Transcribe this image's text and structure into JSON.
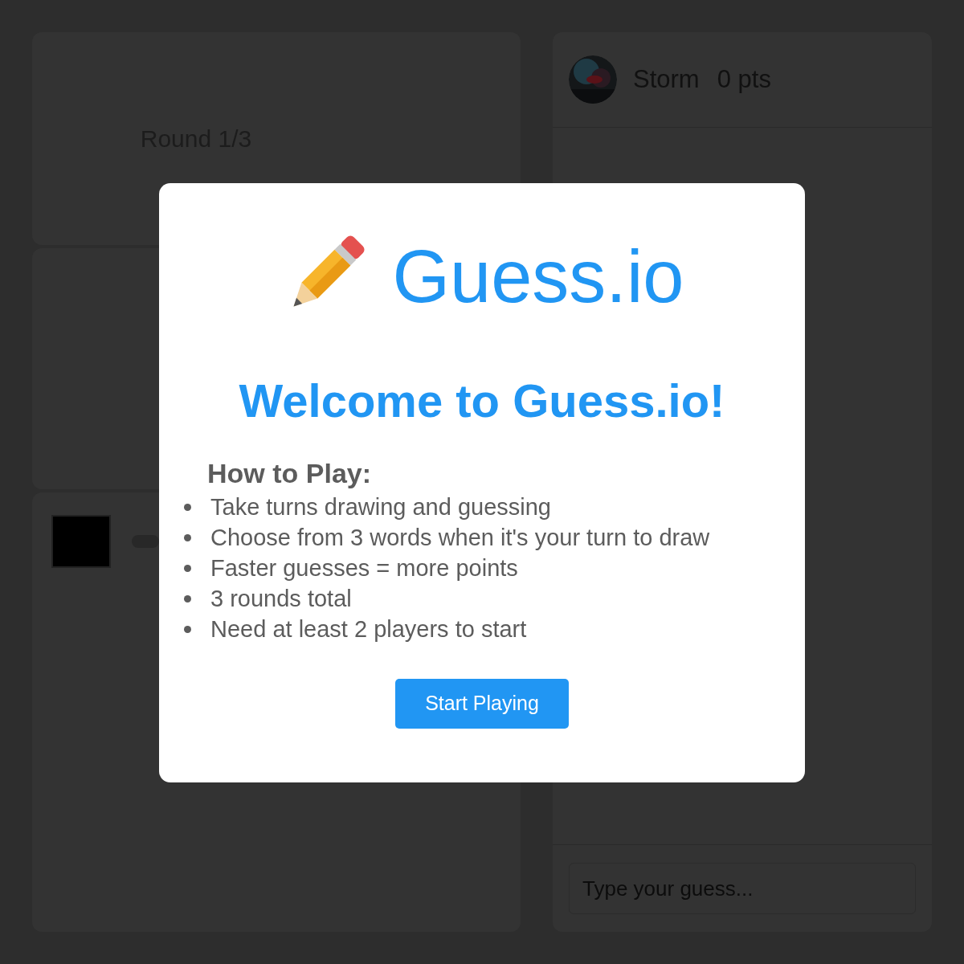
{
  "game": {
    "round": "Round 1/3"
  },
  "players": [
    {
      "name": "Storm",
      "score": "0 pts"
    }
  ],
  "chat": {
    "placeholder": "Type your guess..."
  },
  "modal": {
    "logo_text": "Guess.io",
    "heading": "Welcome to Guess.io!",
    "instructions_title": "How to Play:",
    "instructions": [
      "Take turns drawing and guessing",
      "Choose from 3 words when it's your turn to draw",
      "Faster guesses = more points",
      "3 rounds total",
      "Need at least 2 players to start"
    ],
    "button": "Start Playing"
  }
}
